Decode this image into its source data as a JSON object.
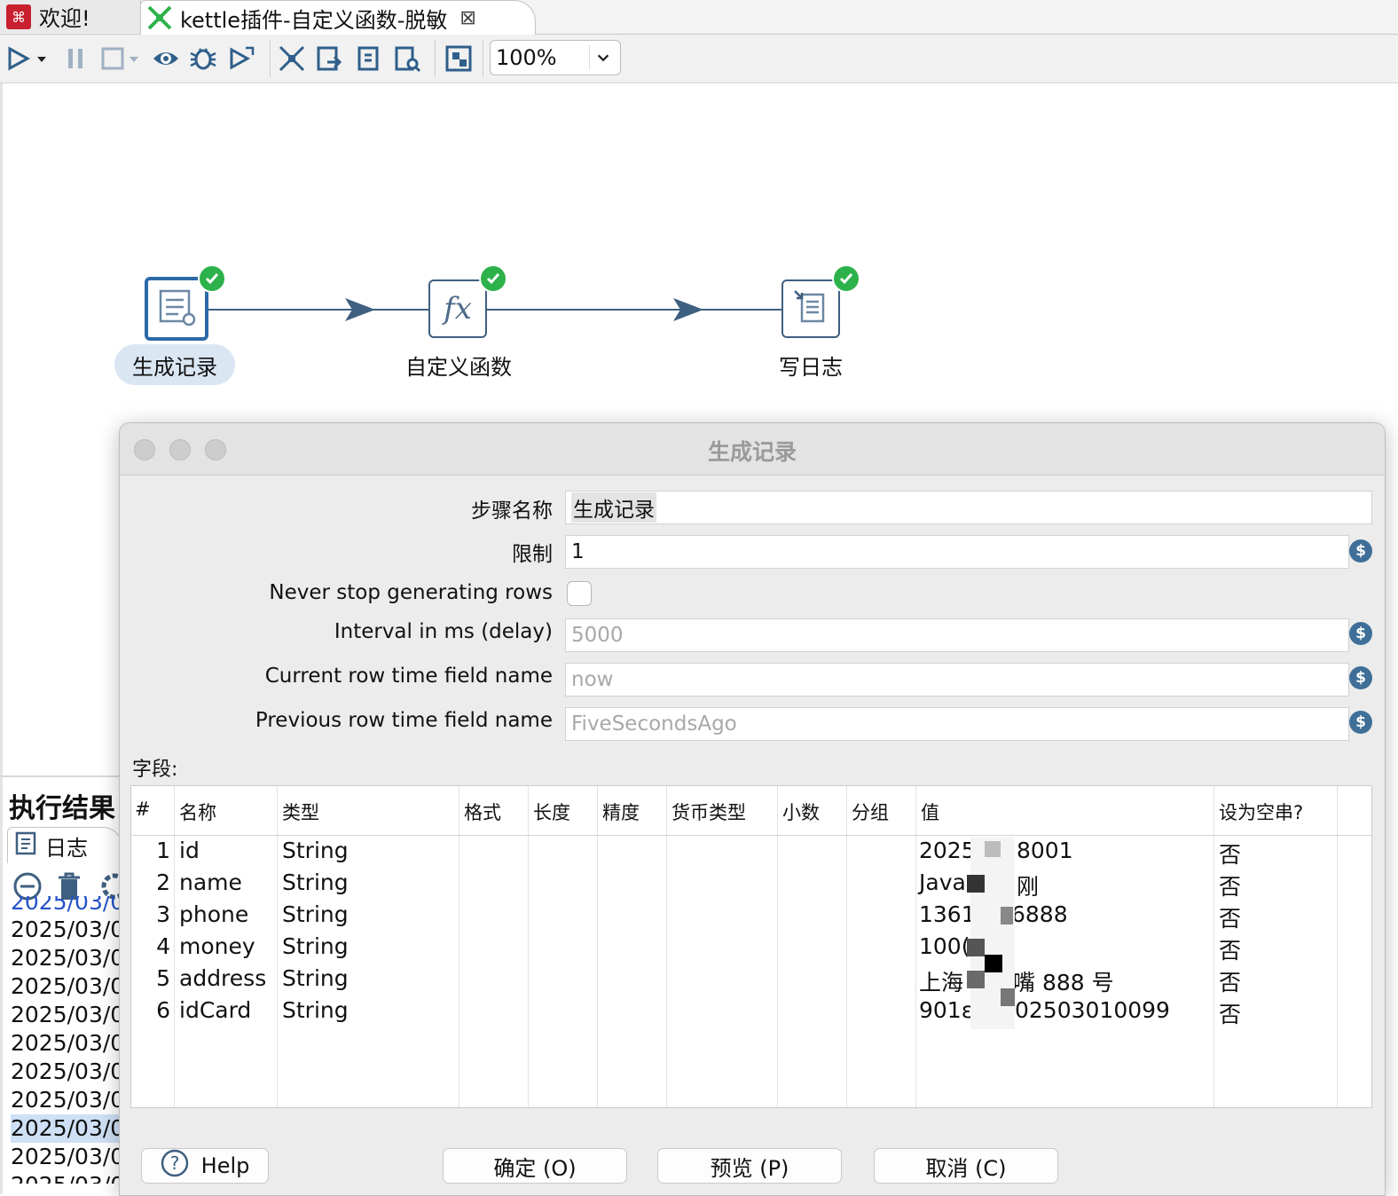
{
  "tabs": [
    {
      "label": "欢迎!"
    },
    {
      "label": "kettle插件-自定义函数-脱敏"
    }
  ],
  "toolbar": {
    "zoom": "100%"
  },
  "transformation": {
    "steps": [
      {
        "label": "生成记录",
        "icon": "generate-rows-icon",
        "status": "ok"
      },
      {
        "label": "自定义函数",
        "icon": "fx-icon",
        "status": "ok"
      },
      {
        "label": "写日志",
        "icon": "write-log-icon",
        "status": "ok"
      }
    ]
  },
  "results": {
    "title": "执行结果",
    "log_tab": "日志",
    "log_lines": [
      "2025/03/0",
      "2025/03/0",
      "2025/03/0",
      "2025/03/0",
      "2025/03/0",
      "2025/03/0",
      "2025/03/0",
      "2025/03/0",
      "2025/03/0",
      "2025/03/0",
      "2025/03/0"
    ]
  },
  "dialog": {
    "title": "生成记录",
    "fields": {
      "step_name_label": "步骤名称",
      "step_name_value": "生成记录",
      "limit_label": "限制",
      "limit_value": "1",
      "never_stop_label": "Never stop generating rows",
      "never_stop_checked": false,
      "interval_label": "Interval in ms (delay)",
      "interval_value": "5000",
      "current_time_label": "Current row time field name",
      "current_time_value": "now",
      "previous_time_label": "Previous row time field name",
      "previous_time_value": "FiveSecondsAgo"
    },
    "fields_section_label": "字段:",
    "grid": {
      "columns": [
        "#",
        "名称",
        "类型",
        "格式",
        "长度",
        "精度",
        "货币类型",
        "小数",
        "分组",
        "值",
        "设为空串?"
      ],
      "rows": [
        {
          "num": "1",
          "name": "id",
          "type": "String",
          "value_a": "2025",
          "value_b": "8001",
          "empty": "否"
        },
        {
          "num": "2",
          "name": "name",
          "type": "String",
          "value_a": "Java",
          "value_b": "刚",
          "empty": "否"
        },
        {
          "num": "3",
          "name": "phone",
          "type": "String",
          "value_a": "1361",
          "value_b": "6888",
          "empty": "否"
        },
        {
          "num": "4",
          "name": "money",
          "type": "String",
          "value_a": "100(",
          "value_b": "",
          "empty": "否"
        },
        {
          "num": "5",
          "name": "address",
          "type": "String",
          "value_a": "上海",
          "value_b": "嘴 888 号",
          "empty": "否"
        },
        {
          "num": "6",
          "name": "idCard",
          "type": "String",
          "value_a": "901ε",
          "value_b": "02503010099",
          "empty": "否"
        }
      ]
    },
    "buttons": {
      "help": "Help",
      "ok": "确定 (O)",
      "preview": "预览 (P)",
      "cancel": "取消 (C)"
    }
  },
  "colors": {
    "accent": "#3e5f80",
    "selected_step": "#2c69a8",
    "check": "#2db24b",
    "dialog_bg": "#ececec"
  }
}
